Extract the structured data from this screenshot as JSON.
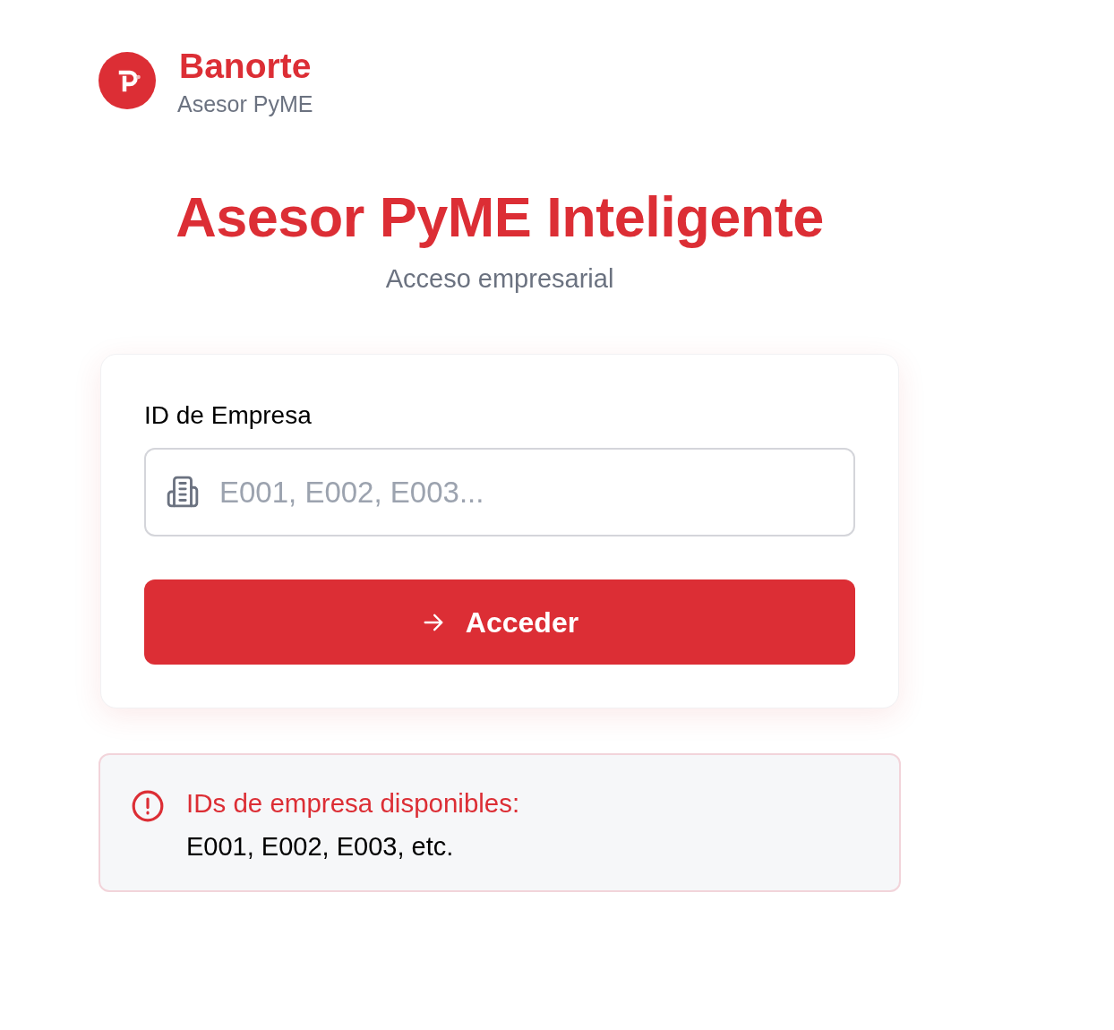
{
  "brand": {
    "name": "Banorte",
    "subtitle": "Asesor PyME"
  },
  "heading": {
    "title": "Asesor PyME Inteligente",
    "subtitle": "Acceso empresarial"
  },
  "login_form": {
    "field": {
      "label": "ID de Empresa",
      "placeholder": "E001, E002, E003..."
    },
    "submit_button": {
      "label": "Acceder"
    }
  },
  "info_notice": {
    "title": "IDs de empresa disponibles:",
    "text": "E001, E002, E003, etc."
  }
}
